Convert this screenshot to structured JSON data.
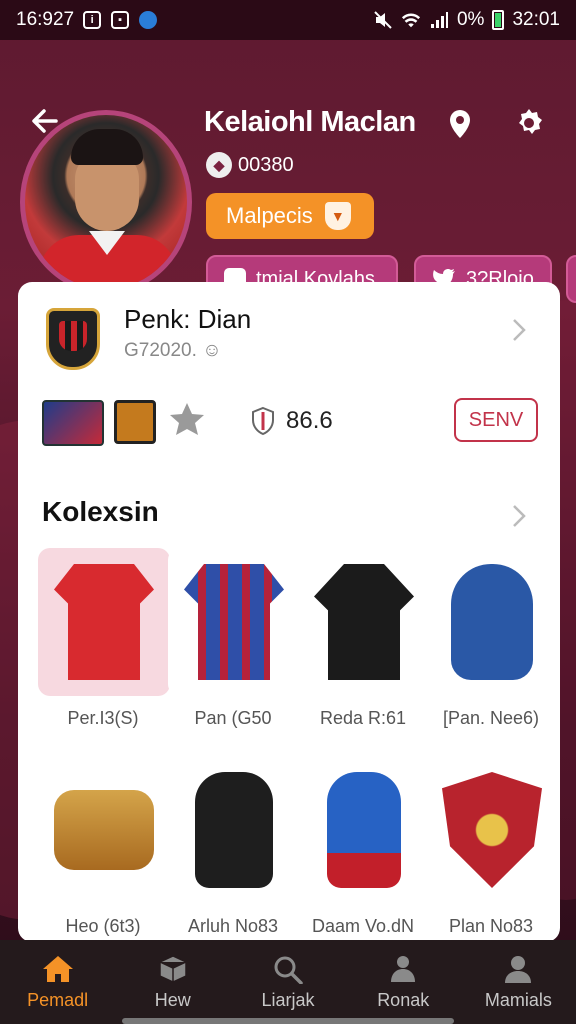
{
  "status_bar": {
    "time": "16:927",
    "battery_text": "0%",
    "clock_right": "32:01"
  },
  "header": {
    "user_name": "Kelaiohl Maclan",
    "user_id": "00380",
    "rank_label": "Malpecis",
    "social": [
      {
        "label": "tmial Kovlahs",
        "icon": "facebook-icon"
      },
      {
        "label": "3?Rlojo",
        "icon": "twitter-icon"
      }
    ]
  },
  "team": {
    "name": "Penk: Dian",
    "subtitle": "G72020.",
    "score": "86.6",
    "send_label": "SENV"
  },
  "collection": {
    "title": "Kolexsin",
    "items": [
      {
        "label": "Per.I3(S)",
        "name": "red-jersey",
        "color": "#d82a2f"
      },
      {
        "label": "Pan (G50",
        "name": "blue-jersey",
        "color": "#2f4fa8"
      },
      {
        "label": "Reda R:61",
        "name": "black-hoodie",
        "color": "#1b1b1b"
      },
      {
        "label": "[Pan. Nee6)",
        "name": "blue-backpack",
        "color": "#2a58a6"
      },
      {
        "label": "Heo (6t3)",
        "name": "gold-cup",
        "color": "#c8902e"
      },
      {
        "label": "Arluh No83",
        "name": "black-backpack",
        "color": "#1e1e1e"
      },
      {
        "label": "Daam Vo.dN",
        "name": "blue-bag",
        "color": "#2762c4"
      },
      {
        "label": "Plan No83",
        "name": "club-crest",
        "color": "#b8232d"
      }
    ]
  },
  "nav": [
    {
      "label": "Pemadl",
      "icon": "home-icon",
      "active": true
    },
    {
      "label": "Hew",
      "icon": "box-icon",
      "active": false
    },
    {
      "label": "Liarjak",
      "icon": "search-icon",
      "active": false
    },
    {
      "label": "Ronak",
      "icon": "trophy-icon",
      "active": false
    },
    {
      "label": "Mamials",
      "icon": "profile-icon",
      "active": false
    }
  ],
  "colors": {
    "accent": "#f49227",
    "brand": "#6b1d35",
    "send": "#c2334a"
  }
}
